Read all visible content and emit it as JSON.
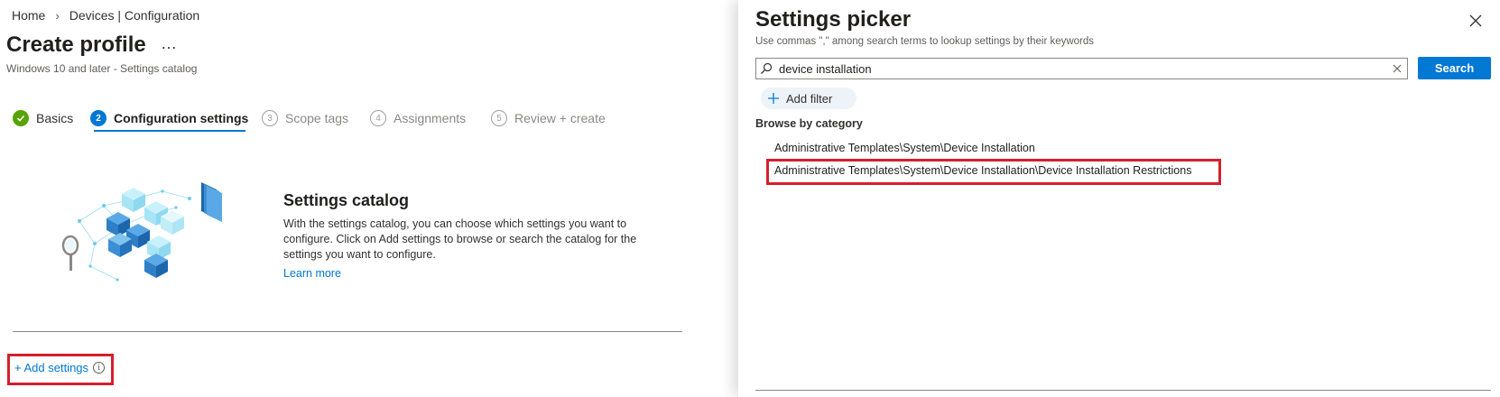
{
  "breadcrumb": {
    "home": "Home",
    "separator": "›",
    "devices": "Devices | Configuration"
  },
  "header": {
    "title": "Create profile",
    "more": "…",
    "subtitle": "Windows 10 and later - Settings catalog"
  },
  "wizard": {
    "steps": [
      {
        "number": "✓",
        "label": "Basics",
        "state": "done"
      },
      {
        "number": "2",
        "label": "Configuration settings",
        "state": "active"
      },
      {
        "number": "3",
        "label": "Scope tags",
        "state": "pending"
      },
      {
        "number": "4",
        "label": "Assignments",
        "state": "pending"
      },
      {
        "number": "5",
        "label": "Review + create",
        "state": "pending"
      }
    ]
  },
  "catalog": {
    "title": "Settings catalog",
    "description": "With the settings catalog, you can choose which settings you want to configure. Click on Add settings to browse or search the catalog for the settings you want to configure.",
    "learn_more": "Learn more"
  },
  "add_settings": {
    "label": "+ Add settings",
    "info_icon": "i"
  },
  "picker": {
    "title": "Settings picker",
    "subtitle": "Use commas \",\" among search terms to lookup settings by their keywords",
    "search_value": "device installation",
    "search_button": "Search",
    "add_filter": "Add filter",
    "browse_label": "Browse by category",
    "categories": [
      "Administrative Templates\\System\\Device Installation",
      "Administrative Templates\\System\\Device Installation\\Device Installation Restrictions"
    ]
  },
  "colors": {
    "accent": "#0078d4",
    "success": "#57a300",
    "highlight": "#d61f2c",
    "filter_bg": "#eef3f9"
  },
  "icons": {
    "search": "search-icon",
    "clear": "clear-icon",
    "close": "close-icon",
    "add": "plus-icon",
    "info": "info-icon",
    "check": "checkmark-icon"
  }
}
